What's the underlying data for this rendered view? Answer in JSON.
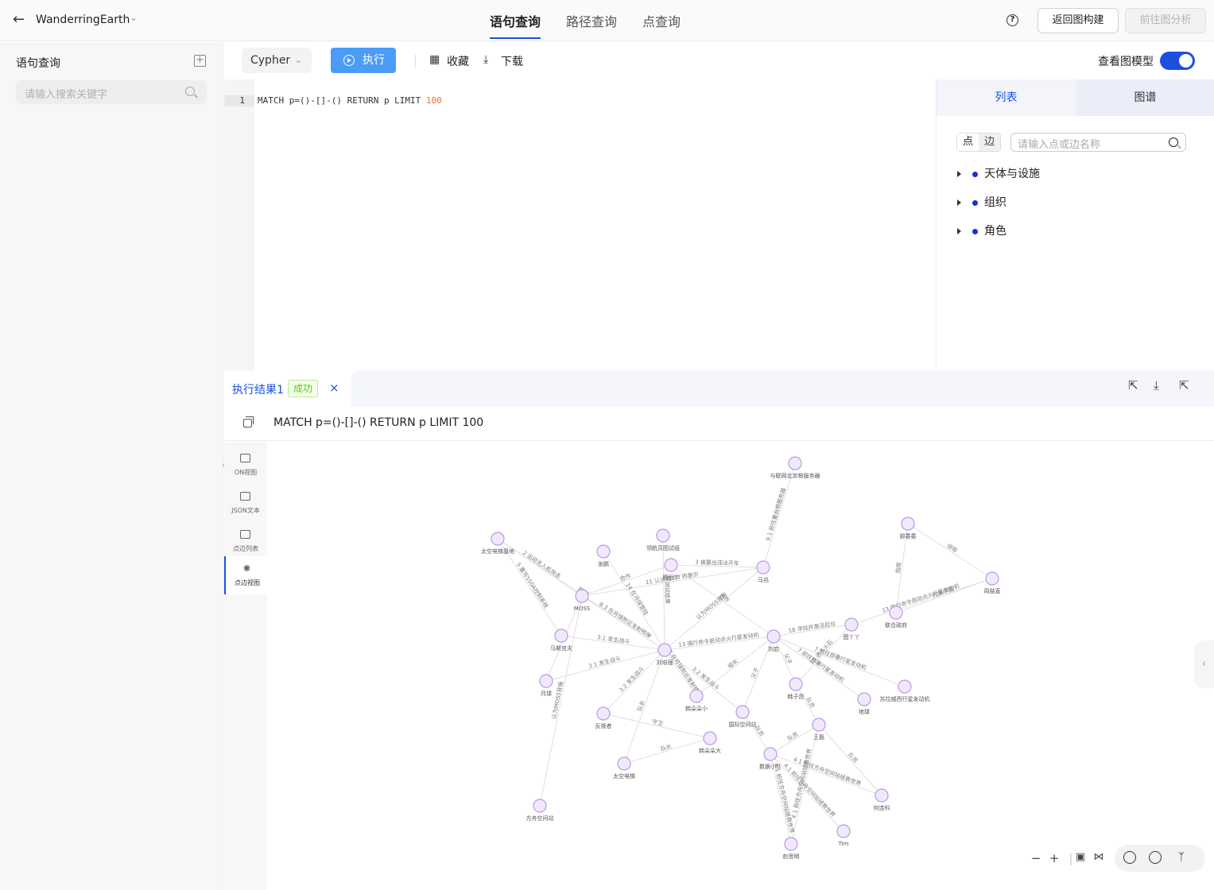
{
  "header": {
    "project": "WanderringEarth",
    "tabs": [
      {
        "label": "语句查询",
        "active": true
      },
      {
        "label": "路径查询",
        "active": false
      },
      {
        "label": "点查询",
        "active": false
      }
    ],
    "help": "?",
    "back_build": "返回图构建",
    "goto_analysis": "前往图分析"
  },
  "sidebar": {
    "title": "语句查询",
    "search_placeholder": "请输入搜索关键字"
  },
  "toolbar": {
    "language": "Cypher",
    "run": "执行",
    "favorite": "收藏",
    "download": "下载",
    "model_toggle_label": "查看图模型",
    "model_toggle_on": true
  },
  "editor": {
    "line_number": "1",
    "code_prefix": "MATCH p=()-[]-() RETURN p LIMIT ",
    "code_number": "100"
  },
  "schema_panel": {
    "tabs": [
      "列表",
      "图谱"
    ],
    "seg_node": "点",
    "seg_edge": "边",
    "search_placeholder": "请输入点或边名称",
    "items": [
      "天体与设施",
      "组织",
      "角色"
    ],
    "dot_color": "#1a2fd6"
  },
  "result": {
    "tab_label": "执行结果1",
    "status": "成功",
    "close": "×",
    "query": "MATCH p=()-[]-() RETURN p LIMIT 100",
    "views": [
      "ON视图",
      "JSON文本",
      "点边列表",
      "点边视图"
    ],
    "active_view": "点边视图"
  },
  "graph": {
    "node_color": "#f1e9fb",
    "node_border": "#b898e8",
    "nodes": [
      "与联网北京根服务器",
      "太空电梯基地",
      "张鹏",
      "领航员图试组",
      "部委委",
      "周喆直",
      "MOSS",
      "联合政府",
      "图恒宇",
      "马兆",
      "马斯克夫",
      "刘培强",
      "刘启",
      "月球",
      "韩朵朵小",
      "韩子昂",
      "地球",
      "苏拉威西行星发动机",
      "反叛者",
      "国际空间站",
      "王磊",
      "韩朵朵大",
      "数据小队",
      "太空电梯",
      "何连科",
      "方舟空间站",
      "Tim",
      "赵思明",
      "图丫丫"
    ],
    "edge_labels": [
      "9.1 前往重启根服务器",
      "2 出动无人机攻击",
      "14 在月球登陆",
      "控制",
      "5 重写550A控制系统",
      "测试结果",
      "领导",
      "指挥",
      "代表中国",
      "13 强行命令启动点火行星发动机",
      "11 认识图丫丫的意识",
      "合作",
      "3 被要出违法开车",
      "18 寻找并激活后台",
      "15 进入火石",
      "7 前往部署行星发动机",
      "3.1 发生战斗",
      "3.2 发生战斗",
      "守卫",
      "队长",
      "队员",
      "4.1 前往方舟空间站拯救世界",
      "认为MOSS背叛",
      "8.3 在月球附近发射核弹",
      "战友",
      "父子",
      "组长"
    ]
  },
  "icons": {
    "back": "arrow-left-icon",
    "caret": "chevron-down-icon",
    "add": "plus-square-icon",
    "search": "search-icon",
    "run": "play-circle-icon",
    "favorite": "grid-icon",
    "download": "download-icon"
  }
}
